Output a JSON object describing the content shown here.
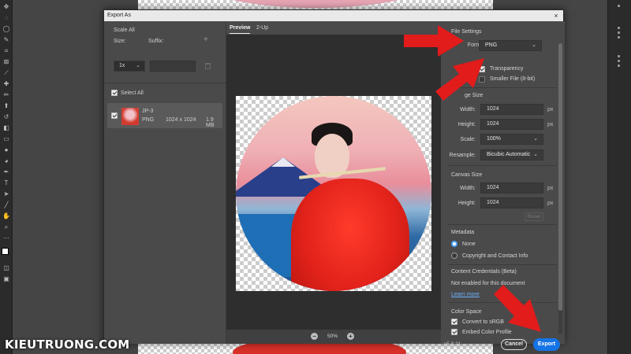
{
  "dialog": {
    "title": "Export As",
    "close_glyph": "×"
  },
  "left_pane": {
    "scale_all": "Scale All",
    "size_label": "Size:",
    "suffix_label": "Suffix:",
    "size_value": "1x",
    "select_all": "Select All",
    "file": {
      "name": "JP-3",
      "format": "PNG",
      "dimensions": "1024 x 1024",
      "filesize": "1.9 MB"
    }
  },
  "center_pane": {
    "tabs": [
      "Preview",
      "2-Up"
    ],
    "active_tab": "Preview",
    "zoom": "50%"
  },
  "right_pane": {
    "file_settings": {
      "heading": "File Settings",
      "format_label": "Format:",
      "format_value": "PNG",
      "transparency_label": "Transparency",
      "transparency_checked": true,
      "smaller_file_label": "Smaller File (8-bit)",
      "smaller_file_checked": false
    },
    "image_size": {
      "heading": "ge Size",
      "width_label": "Width:",
      "width_value": "1024",
      "height_label": "Height:",
      "height_value": "1024",
      "unit": "px",
      "scale_label": "Scale:",
      "scale_value": "100%",
      "resample_label": "Resample:",
      "resample_value": "Bicubic Automatic"
    },
    "canvas_size": {
      "heading": "Canvas Size",
      "width_label": "Width:",
      "width_value": "1024",
      "height_label": "Height:",
      "height_value": "1024",
      "unit": "px",
      "reset_label": "Reset"
    },
    "metadata": {
      "heading": "Metadata",
      "option_none": "None",
      "option_copyright": "Copyright and Contact Info",
      "selected": "None"
    },
    "content_credentials": {
      "heading": "Content Credentials (Beta)",
      "status": "Not enabled for this document",
      "learn_more": "Learn more"
    },
    "color_space": {
      "heading": "Color Space",
      "convert_label": "Convert to sRGB",
      "embed_label": "Embed Color Profile"
    },
    "version": "v5.8.21",
    "cancel_label": "Cancel",
    "export_label": "Export"
  },
  "watermark": "KIEUTRUONG.COM",
  "colors": {
    "accent": "#1473e6",
    "arrow": "#e21b1b",
    "dialog_bg": "#4a4a4a"
  },
  "icons": [
    "close-icon",
    "plus-icon",
    "trash-icon",
    "chevron-down-icon",
    "zoom-out-icon",
    "zoom-in-icon"
  ]
}
